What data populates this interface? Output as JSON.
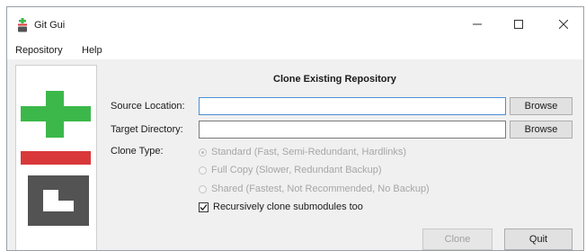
{
  "window": {
    "title": "Git Gui",
    "icon": "git-gui-app-icon",
    "controls": {
      "minimize": "minimize-icon",
      "maximize": "maximize-icon",
      "close": "close-icon"
    }
  },
  "menubar": {
    "items": [
      "Repository",
      "Help"
    ]
  },
  "logo": {
    "icon": "git-logo",
    "colors": {
      "green": "#3cb84a",
      "red": "#d9383a",
      "gray": "#535353"
    }
  },
  "dialog": {
    "title": "Clone Existing Repository",
    "source_location": {
      "label": "Source Location:",
      "value": ""
    },
    "target_directory": {
      "label": "Target Directory:",
      "value": ""
    },
    "browse_label": "Browse",
    "clone_type": {
      "label": "Clone Type:",
      "options": [
        {
          "label": "Standard (Fast, Semi-Redundant, Hardlinks)",
          "selected": true,
          "enabled": false
        },
        {
          "label": "Full Copy (Slower, Redundant Backup)",
          "selected": false,
          "enabled": false
        },
        {
          "label": "Shared (Fastest, Not Recommended, No Backup)",
          "selected": false,
          "enabled": false
        }
      ]
    },
    "recursive": {
      "label": "Recursively clone submodules too",
      "checked": true
    },
    "buttons": {
      "clone": {
        "label": "Clone",
        "enabled": false
      },
      "quit": {
        "label": "Quit",
        "enabled": true
      }
    }
  }
}
